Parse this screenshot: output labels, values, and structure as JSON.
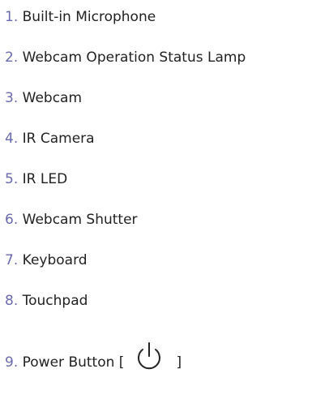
{
  "items": [
    {
      "num": "1.",
      "label": "Built-in Microphone"
    },
    {
      "num": "2.",
      "label": "Webcam Operation Status Lamp"
    },
    {
      "num": "3.",
      "label": "Webcam"
    },
    {
      "num": "4.",
      "label": "IR Camera"
    },
    {
      "num": "5.",
      "label": "IR LED"
    },
    {
      "num": "6.",
      "label": "Webcam Shutter"
    },
    {
      "num": "7.",
      "label": "Keyboard"
    },
    {
      "num": "8.",
      "label": "Touchpad"
    },
    {
      "num": "9.",
      "label": "Power Button",
      "open_bracket": "[",
      "close_bracket": "]",
      "icon": "power-icon"
    }
  ]
}
